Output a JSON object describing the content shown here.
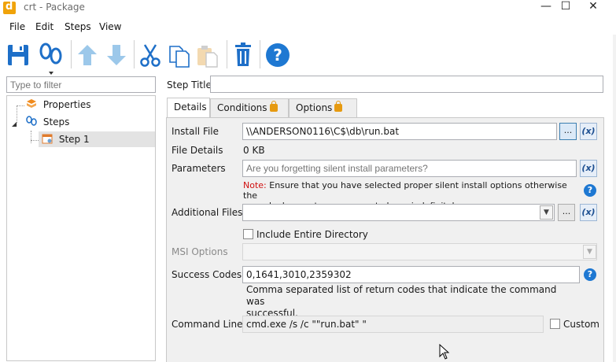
{
  "window": {
    "title": "crt - Package",
    "minimize": "—",
    "maximize": "☐",
    "close": "✕"
  },
  "menu": [
    "File",
    "Edit",
    "Steps",
    "View"
  ],
  "toolbar": {
    "buttons": [
      "save-icon",
      "steps-icon",
      "move-up-icon",
      "move-down-icon",
      "cut-icon",
      "copy-icon",
      "paste-icon",
      "delete-icon",
      "help-icon"
    ]
  },
  "filter": {
    "placeholder": "Type to filter"
  },
  "tree": {
    "items": [
      {
        "label": "Properties",
        "icon": "properties-icon"
      },
      {
        "label": "Steps",
        "icon": "steps-icon"
      },
      {
        "label": "Step 1",
        "icon": "step-icon"
      }
    ]
  },
  "step_title": {
    "label": "Step Title",
    "value": ""
  },
  "tabs": [
    {
      "label": "Details",
      "locked": false,
      "active": true
    },
    {
      "label": "Conditions",
      "locked": true,
      "active": false
    },
    {
      "label": "Options",
      "locked": true,
      "active": false
    }
  ],
  "details": {
    "install_file": {
      "label": "Install File",
      "value": "\\\\ANDERSON0116\\C$\\db\\run.bat",
      "browse": "...",
      "variable": "(x)"
    },
    "file_details": {
      "label": "File Details",
      "value": "0 KB"
    },
    "parameters": {
      "label": "Parameters",
      "placeholder": "Are you forgetting silent install parameters?",
      "variable": "(x)"
    },
    "note": {
      "prefix": "Note:",
      "line1": " Ensure that you have selected proper silent install options otherwise the",
      "line2": "deployment may appear to hang indefinitely.",
      "help": "?"
    },
    "additional_files": {
      "label": "Additional Files",
      "value": "",
      "browse": "...",
      "variable": "(x)"
    },
    "include_dir": {
      "label": "Include Entire Directory",
      "checked": false
    },
    "msi_options": {
      "label": "MSI Options",
      "value": ""
    },
    "success_codes": {
      "label": "Success Codes",
      "value": "0,1641,3010,2359302",
      "help": "?",
      "desc_line1": "Comma separated list of return codes that indicate the command was",
      "desc_line2": "successful."
    },
    "command_line": {
      "label": "Command Line",
      "value": "cmd.exe /s /c \"\"run.bat\" \"",
      "custom_label": "Custom",
      "custom_checked": false
    }
  },
  "colors": {
    "accent": "#1e78d2",
    "save": "#1e6fc8",
    "lock": "#e69a10",
    "note": "#d01010"
  }
}
